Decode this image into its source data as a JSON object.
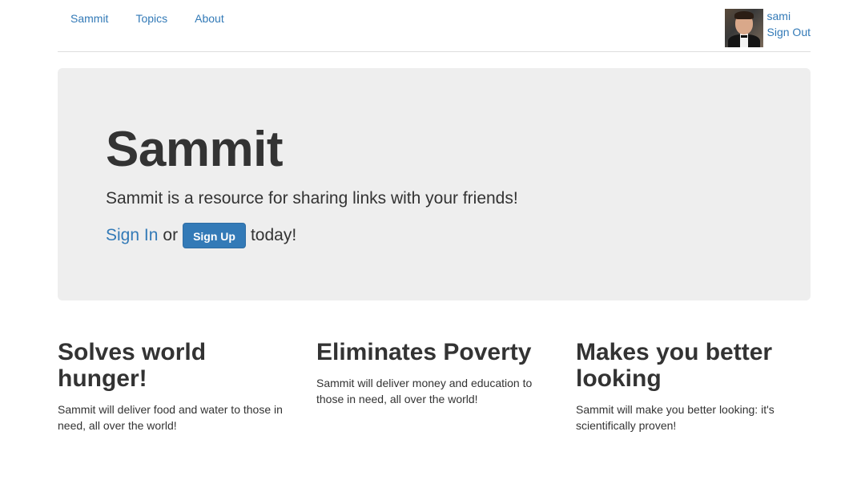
{
  "nav": {
    "links": [
      "Sammit",
      "Topics",
      "About"
    ],
    "user": {
      "username": "sami",
      "signout_label": "Sign Out",
      "avatar_icon": "user-avatar-photo"
    }
  },
  "jumbotron": {
    "title": "Sammit",
    "lead": "Sammit is a resource for sharing links with your friends!",
    "signin_label": "Sign In",
    "or_text": "or",
    "signup_label": "Sign Up",
    "today_text": "today!"
  },
  "features": [
    {
      "title": "Solves world hunger!",
      "body": "Sammit will deliver food and water to those in need, all over the world!"
    },
    {
      "title": "Eliminates Poverty",
      "body": "Sammit will deliver money and education to those in need, all over the world!"
    },
    {
      "title": "Makes you better looking",
      "body": "Sammit will make you better looking: it's scientifically proven!"
    }
  ],
  "colors": {
    "link": "#337ab7",
    "jumbotron_bg": "#eeeeee",
    "text": "#333333",
    "button_bg": "#337ab7"
  }
}
